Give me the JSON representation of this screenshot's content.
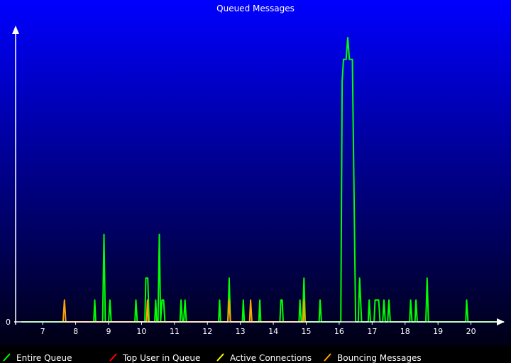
{
  "chart_data": {
    "type": "line",
    "title": "Queued Messages",
    "xlabel": "",
    "ylabel": "",
    "xlim": [
      6.35,
      21.0
    ],
    "ylim": [
      0,
      13
    ],
    "x_ticks": [
      7,
      8,
      9,
      10,
      11,
      12,
      13,
      14,
      15,
      16,
      17,
      18,
      19,
      20
    ],
    "y_ticks": [
      0
    ],
    "grid": false,
    "legend_position": "bottom",
    "colors": {
      "background_top": "#0000ff",
      "background_bottom": "#000014",
      "axis": "#ffffff"
    },
    "series": [
      {
        "name": "Entire Queue",
        "color": "#00ff00",
        "points": [
          [
            6.35,
            0
          ],
          [
            8.55,
            0
          ],
          [
            8.58,
            1
          ],
          [
            8.61,
            0
          ],
          [
            8.82,
            0
          ],
          [
            8.86,
            4
          ],
          [
            8.9,
            0
          ],
          [
            9.0,
            0
          ],
          [
            9.04,
            1
          ],
          [
            9.08,
            0
          ],
          [
            9.8,
            0
          ],
          [
            9.83,
            1
          ],
          [
            9.87,
            0
          ],
          [
            10.1,
            0
          ],
          [
            10.13,
            2
          ],
          [
            10.19,
            2
          ],
          [
            10.23,
            0
          ],
          [
            10.4,
            0
          ],
          [
            10.43,
            1
          ],
          [
            10.46,
            0
          ],
          [
            10.5,
            0
          ],
          [
            10.54,
            4
          ],
          [
            10.58,
            0
          ],
          [
            10.62,
            1
          ],
          [
            10.67,
            1
          ],
          [
            10.71,
            0
          ],
          [
            11.17,
            0
          ],
          [
            11.2,
            1
          ],
          [
            11.24,
            0
          ],
          [
            11.28,
            0
          ],
          [
            11.32,
            1
          ],
          [
            11.36,
            0
          ],
          [
            12.34,
            0
          ],
          [
            12.37,
            1
          ],
          [
            12.4,
            0
          ],
          [
            12.62,
            0
          ],
          [
            12.66,
            2
          ],
          [
            12.7,
            0
          ],
          [
            13.06,
            0
          ],
          [
            13.09,
            1
          ],
          [
            13.12,
            0
          ],
          [
            13.56,
            0
          ],
          [
            13.59,
            1
          ],
          [
            13.62,
            0
          ],
          [
            14.2,
            0
          ],
          [
            14.23,
            1
          ],
          [
            14.27,
            1
          ],
          [
            14.3,
            0
          ],
          [
            14.78,
            0
          ],
          [
            14.81,
            1
          ],
          [
            14.85,
            0
          ],
          [
            14.89,
            0
          ],
          [
            14.93,
            2
          ],
          [
            14.97,
            0
          ],
          [
            15.39,
            0
          ],
          [
            15.42,
            1
          ],
          [
            15.46,
            0
          ],
          [
            16.05,
            0
          ],
          [
            16.09,
            11
          ],
          [
            16.13,
            12
          ],
          [
            16.21,
            12
          ],
          [
            16.26,
            13
          ],
          [
            16.31,
            12
          ],
          [
            16.4,
            12
          ],
          [
            16.5,
            0
          ],
          [
            16.58,
            0
          ],
          [
            16.62,
            2
          ],
          [
            16.68,
            0
          ],
          [
            16.88,
            0
          ],
          [
            16.91,
            1
          ],
          [
            16.95,
            0
          ],
          [
            17.06,
            0
          ],
          [
            17.09,
            1
          ],
          [
            17.13,
            1
          ],
          [
            17.17,
            1
          ],
          [
            17.2,
            1
          ],
          [
            17.24,
            0
          ],
          [
            17.32,
            0
          ],
          [
            17.36,
            1
          ],
          [
            17.4,
            0
          ],
          [
            17.47,
            0
          ],
          [
            17.51,
            1
          ],
          [
            17.55,
            0
          ],
          [
            18.14,
            0
          ],
          [
            18.17,
            1
          ],
          [
            18.21,
            0
          ],
          [
            18.3,
            0
          ],
          [
            18.33,
            1
          ],
          [
            18.37,
            0
          ],
          [
            18.63,
            0
          ],
          [
            18.67,
            2
          ],
          [
            18.71,
            0
          ],
          [
            19.84,
            0
          ],
          [
            19.87,
            1
          ],
          [
            19.91,
            0
          ],
          [
            21.0,
            0
          ]
        ]
      },
      {
        "name": "Top User in Queue",
        "color": "#ff0000",
        "points": []
      },
      {
        "name": "Active Connections",
        "color": "#ffff00",
        "points": []
      },
      {
        "name": "Bouncing Messages",
        "color": "#ffa500",
        "points": [
          [
            7.62,
            0
          ],
          [
            7.66,
            1
          ],
          [
            7.7,
            0
          ],
          [
            10.15,
            0
          ],
          [
            10.18,
            1
          ],
          [
            10.21,
            0
          ],
          [
            12.62,
            0
          ],
          [
            12.66,
            1
          ],
          [
            12.7,
            0
          ],
          [
            13.28,
            0
          ],
          [
            13.31,
            1
          ],
          [
            13.35,
            0
          ],
          [
            14.9,
            0
          ],
          [
            14.93,
            1
          ],
          [
            14.96,
            0
          ]
        ]
      }
    ]
  }
}
